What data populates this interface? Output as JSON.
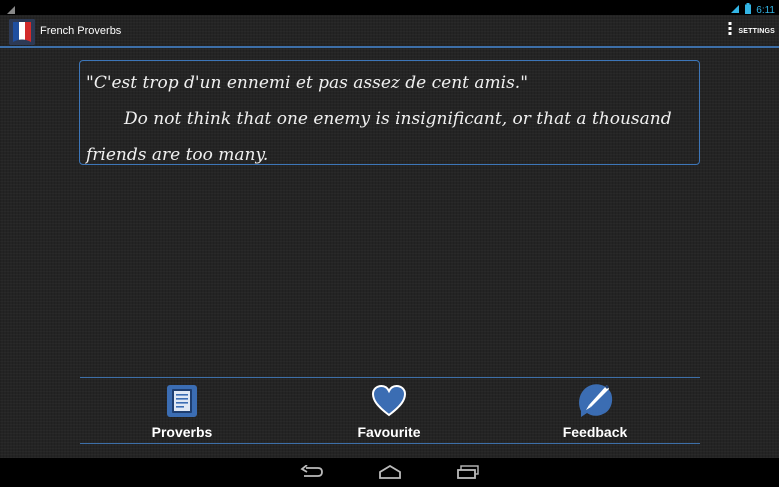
{
  "status_bar": {
    "time": "6:11",
    "icons": [
      "signal-icon",
      "wifi-icon",
      "battery-icon"
    ]
  },
  "action_bar": {
    "title": "French Proverbs",
    "settings_label": "SETTINGS"
  },
  "proverb": {
    "french": "\"C'est trop d'un ennemi et pas assez de cent amis.\"",
    "english_line1": "Do not think that one enemy is insignificant, or that a thousand",
    "english_line2": "friends are too many."
  },
  "bottom_nav": {
    "items": [
      {
        "label": "Proverbs",
        "icon": "book-icon"
      },
      {
        "label": "Favourite",
        "icon": "heart-icon"
      },
      {
        "label": "Feedback",
        "icon": "quill-pen-icon"
      }
    ]
  },
  "system_nav": [
    "back-icon",
    "home-icon",
    "recents-icon"
  ],
  "colors": {
    "accent": "#3d6fa8",
    "icon_blue": "#3b6db3",
    "background": "#242424"
  }
}
